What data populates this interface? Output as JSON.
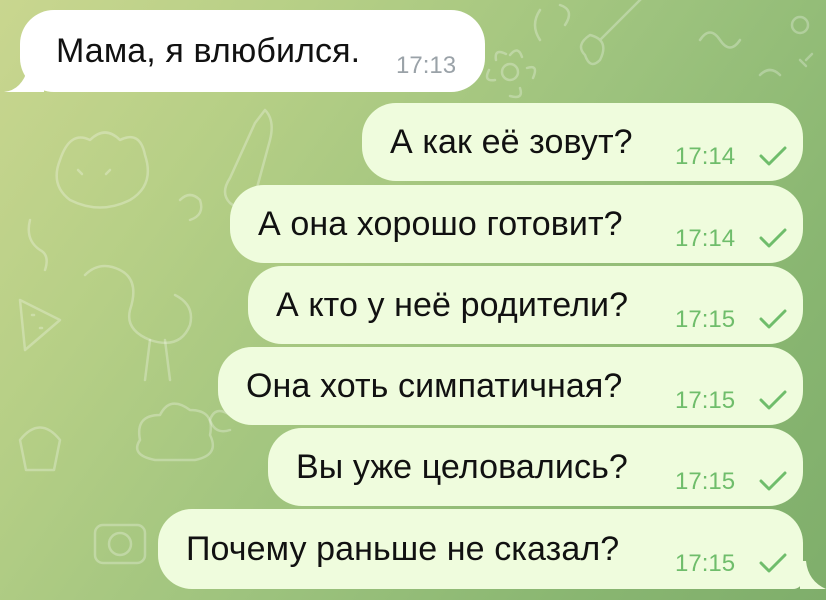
{
  "messages": [
    {
      "direction": "incoming",
      "text": "Мама, я влюбился.",
      "time": "17:13"
    },
    {
      "direction": "outgoing",
      "text": "А как её зовут?",
      "time": "17:14",
      "status": "check-icon"
    },
    {
      "direction": "outgoing",
      "text": "А она хорошо готовит?",
      "time": "17:14",
      "status": "check-icon"
    },
    {
      "direction": "outgoing",
      "text": "А кто у неё родители?",
      "time": "17:15",
      "status": "check-icon"
    },
    {
      "direction": "outgoing",
      "text": "Она хоть симпатичная?",
      "time": "17:15",
      "status": "check-icon"
    },
    {
      "direction": "outgoing",
      "text": "Вы уже целовались?",
      "time": "17:15",
      "status": "check-icon"
    },
    {
      "direction": "outgoing",
      "text": "Почему раньше не сказал?",
      "time": "17:15",
      "status": "check-icon"
    }
  ],
  "colors": {
    "incoming_bubble": "#ffffff",
    "outgoing_bubble": "#effcdd",
    "outgoing_time": "#6fbd6b",
    "incoming_time": "#9aa2a8",
    "wallpaper": "#a3c57f"
  }
}
